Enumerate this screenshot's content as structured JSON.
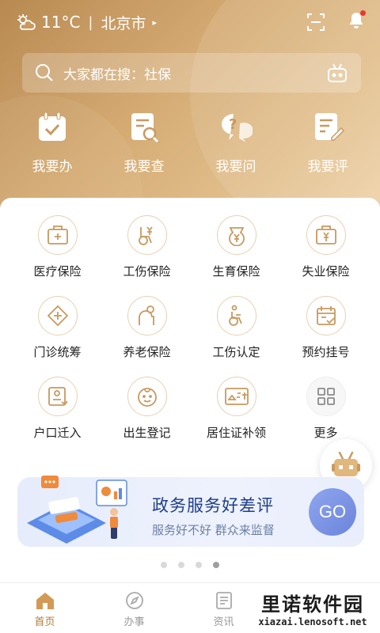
{
  "topbar": {
    "temperature": "11°C",
    "separator": "|",
    "city": "北京市",
    "city_arrow": "▸"
  },
  "search": {
    "placeholder": "大家都在搜：社保"
  },
  "quick": [
    {
      "label": "我要办",
      "icon": "calendar-check-icon"
    },
    {
      "label": "我要查",
      "icon": "document-search-icon"
    },
    {
      "label": "我要问",
      "icon": "question-bubble-icon"
    },
    {
      "label": "我要评",
      "icon": "document-edit-icon"
    }
  ],
  "services": [
    {
      "label": "医疗保险",
      "icon": "medical-box-icon"
    },
    {
      "label": "工伤保险",
      "icon": "wheelchair-yen-icon"
    },
    {
      "label": "生育保险",
      "icon": "pregnancy-yen-icon"
    },
    {
      "label": "失业保险",
      "icon": "briefcase-yen-icon"
    },
    {
      "label": "门诊统筹",
      "icon": "clinic-cross-icon"
    },
    {
      "label": "养老保险",
      "icon": "elderly-icon"
    },
    {
      "label": "工伤认定",
      "icon": "wheelchair-icon"
    },
    {
      "label": "预约挂号",
      "icon": "calendar-appointment-icon"
    },
    {
      "label": "户口迁入",
      "icon": "household-card-icon"
    },
    {
      "label": "出生登记",
      "icon": "baby-face-icon"
    },
    {
      "label": "居住证补领",
      "icon": "residence-card-icon"
    },
    {
      "label": "更多",
      "icon": "grid-more-icon"
    }
  ],
  "banner": {
    "title": "政务服务好差评",
    "subtitle": "服务好不好  群众来监督",
    "button": "GO"
  },
  "pager": {
    "count": 4,
    "active": 3
  },
  "tabs": [
    {
      "label": "首页",
      "active": true
    },
    {
      "label": "办事",
      "active": false
    },
    {
      "label": "资讯",
      "active": false
    }
  ],
  "watermark": {
    "title": "里诺软件园",
    "url": "xiazai.lenosoft.net"
  },
  "colors": {
    "accent": "#b07c3c",
    "icon_gold": "#c9995f",
    "banner_blue": "#1f3f8c"
  }
}
